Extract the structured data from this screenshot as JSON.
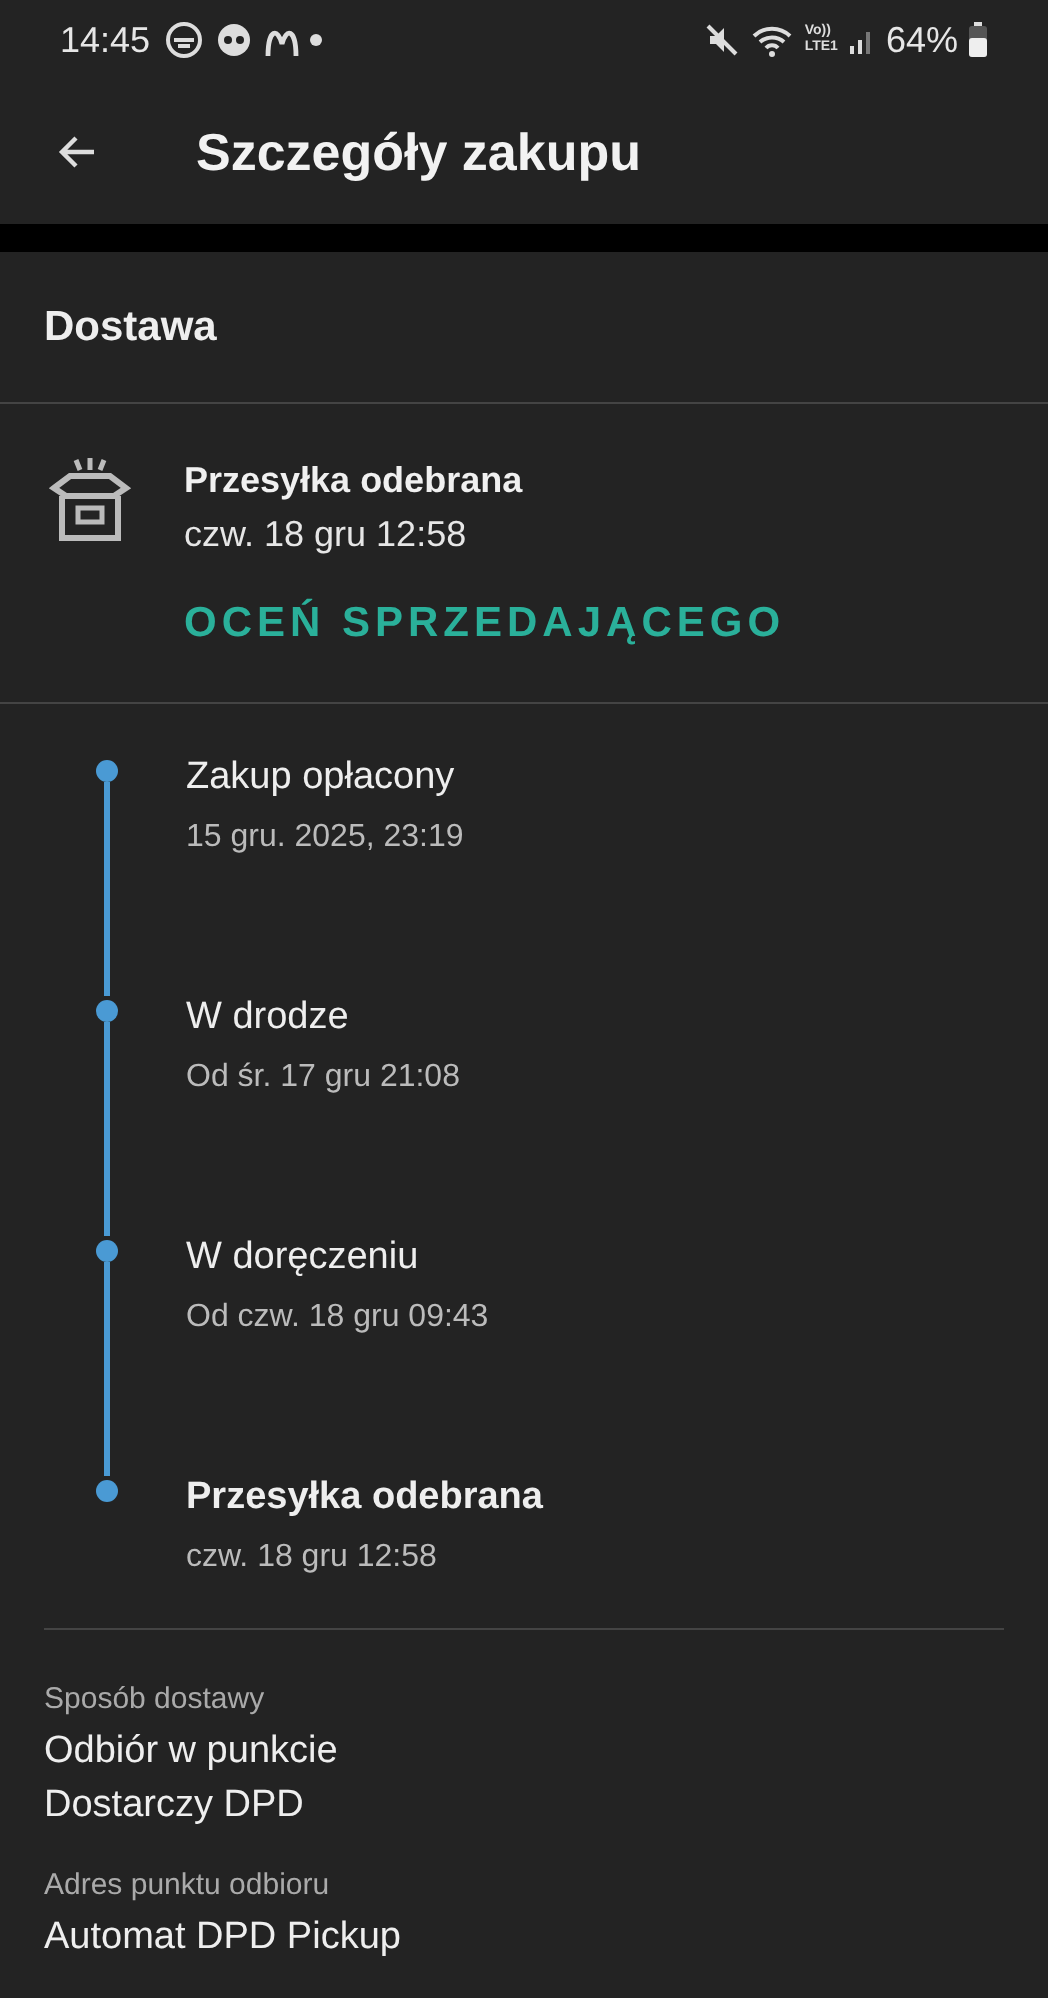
{
  "status_bar": {
    "time": "14:45",
    "battery": "64%",
    "network": "Vo))\nLTE1"
  },
  "app_bar": {
    "title": "Szczegóły zakupu"
  },
  "section": {
    "title": "Dostawa"
  },
  "delivery": {
    "status": "Przesyłka odebrana",
    "date": "czw. 18 gru 12:58",
    "action": "OCEŃ SPRZEDAJĄCEGO"
  },
  "timeline": [
    {
      "title": "Zakup opłacony",
      "date": "15 gru. 2025, 23:19",
      "current": false
    },
    {
      "title": "W drodze",
      "date": "Od śr. 17 gru 21:08",
      "current": false
    },
    {
      "title": "W doręczeniu",
      "date": "Od czw. 18 gru 09:43",
      "current": false
    },
    {
      "title": "Przesyłka odebrana",
      "date": "czw. 18 gru 12:58",
      "current": true
    }
  ],
  "details": [
    {
      "label": "Sposób dostawy",
      "lines": [
        "Odbiór w punkcie",
        "Dostarczy DPD"
      ]
    },
    {
      "label": "Adres punktu odbioru",
      "lines": [
        "Automat DPD Pickup"
      ]
    }
  ]
}
